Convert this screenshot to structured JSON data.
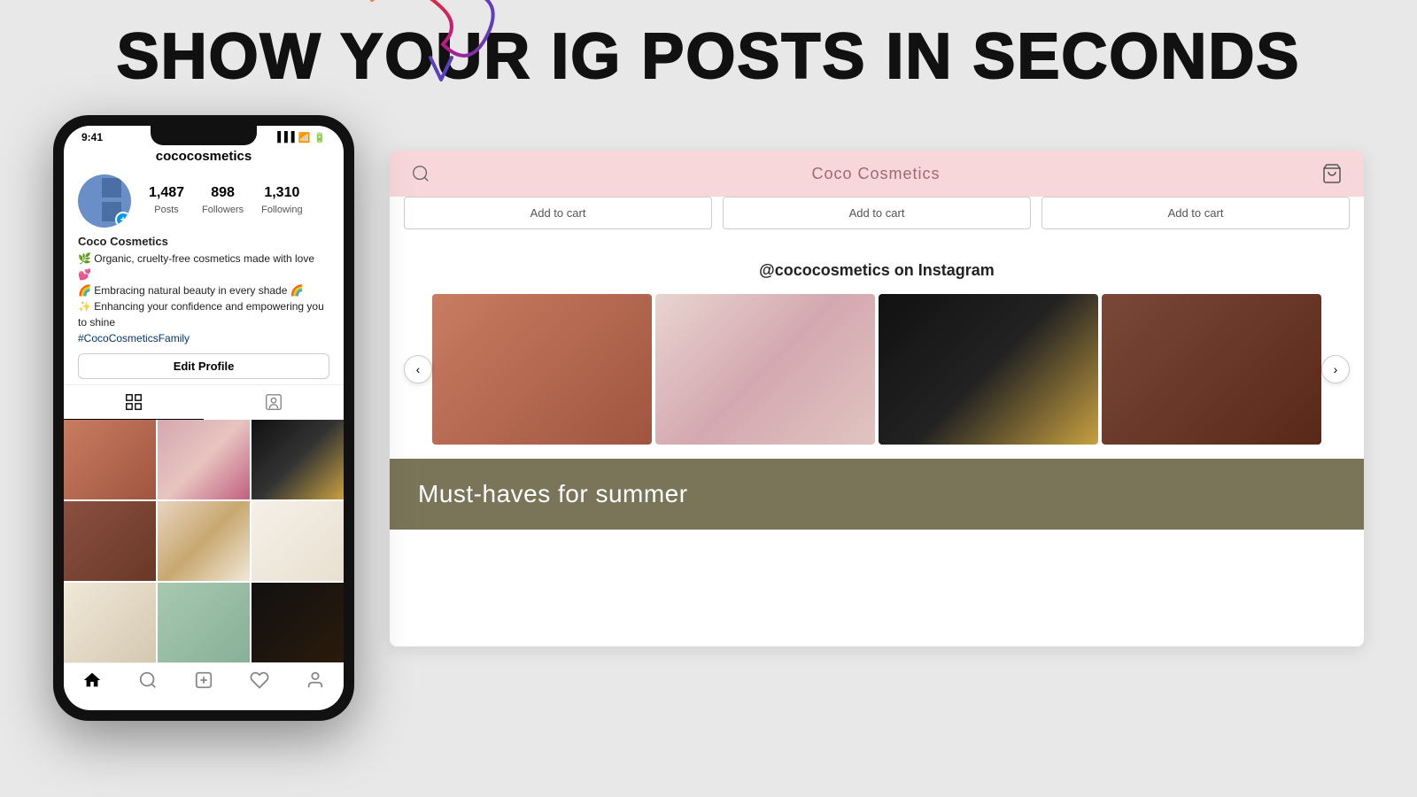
{
  "page": {
    "title": "SHOW YOUR IG POSTS IN SECONDS",
    "background_color": "#e8e8e8"
  },
  "phone": {
    "status_bar": {
      "time": "9:41"
    },
    "instagram": {
      "username": "cococosmetics",
      "stats": [
        {
          "label": "Posts",
          "value": "1,487"
        },
        {
          "label": "Followers",
          "value": "898"
        },
        {
          "label": "Following",
          "value": "1,310"
        }
      ],
      "name": "Coco Cosmetics",
      "bio_lines": [
        "🌿 Organic, cruelty-free cosmetics made with love 💕",
        "🌈 Embracing natural beauty in every shade 🌈",
        "✨ Enhancing your confidence and empowering you to shine",
        "#CocoCosmeticsFamily"
      ],
      "edit_profile_label": "Edit Profile",
      "tabs": [
        "grid",
        "person"
      ]
    }
  },
  "shop": {
    "title": "Coco Cosmetics",
    "add_to_cart_label": "Add to cart",
    "instagram_section_title": "@cococosmetics on Instagram",
    "carousel_prev": "‹",
    "carousel_next": "›",
    "footer_banner_title": "Must-haves for summer"
  }
}
